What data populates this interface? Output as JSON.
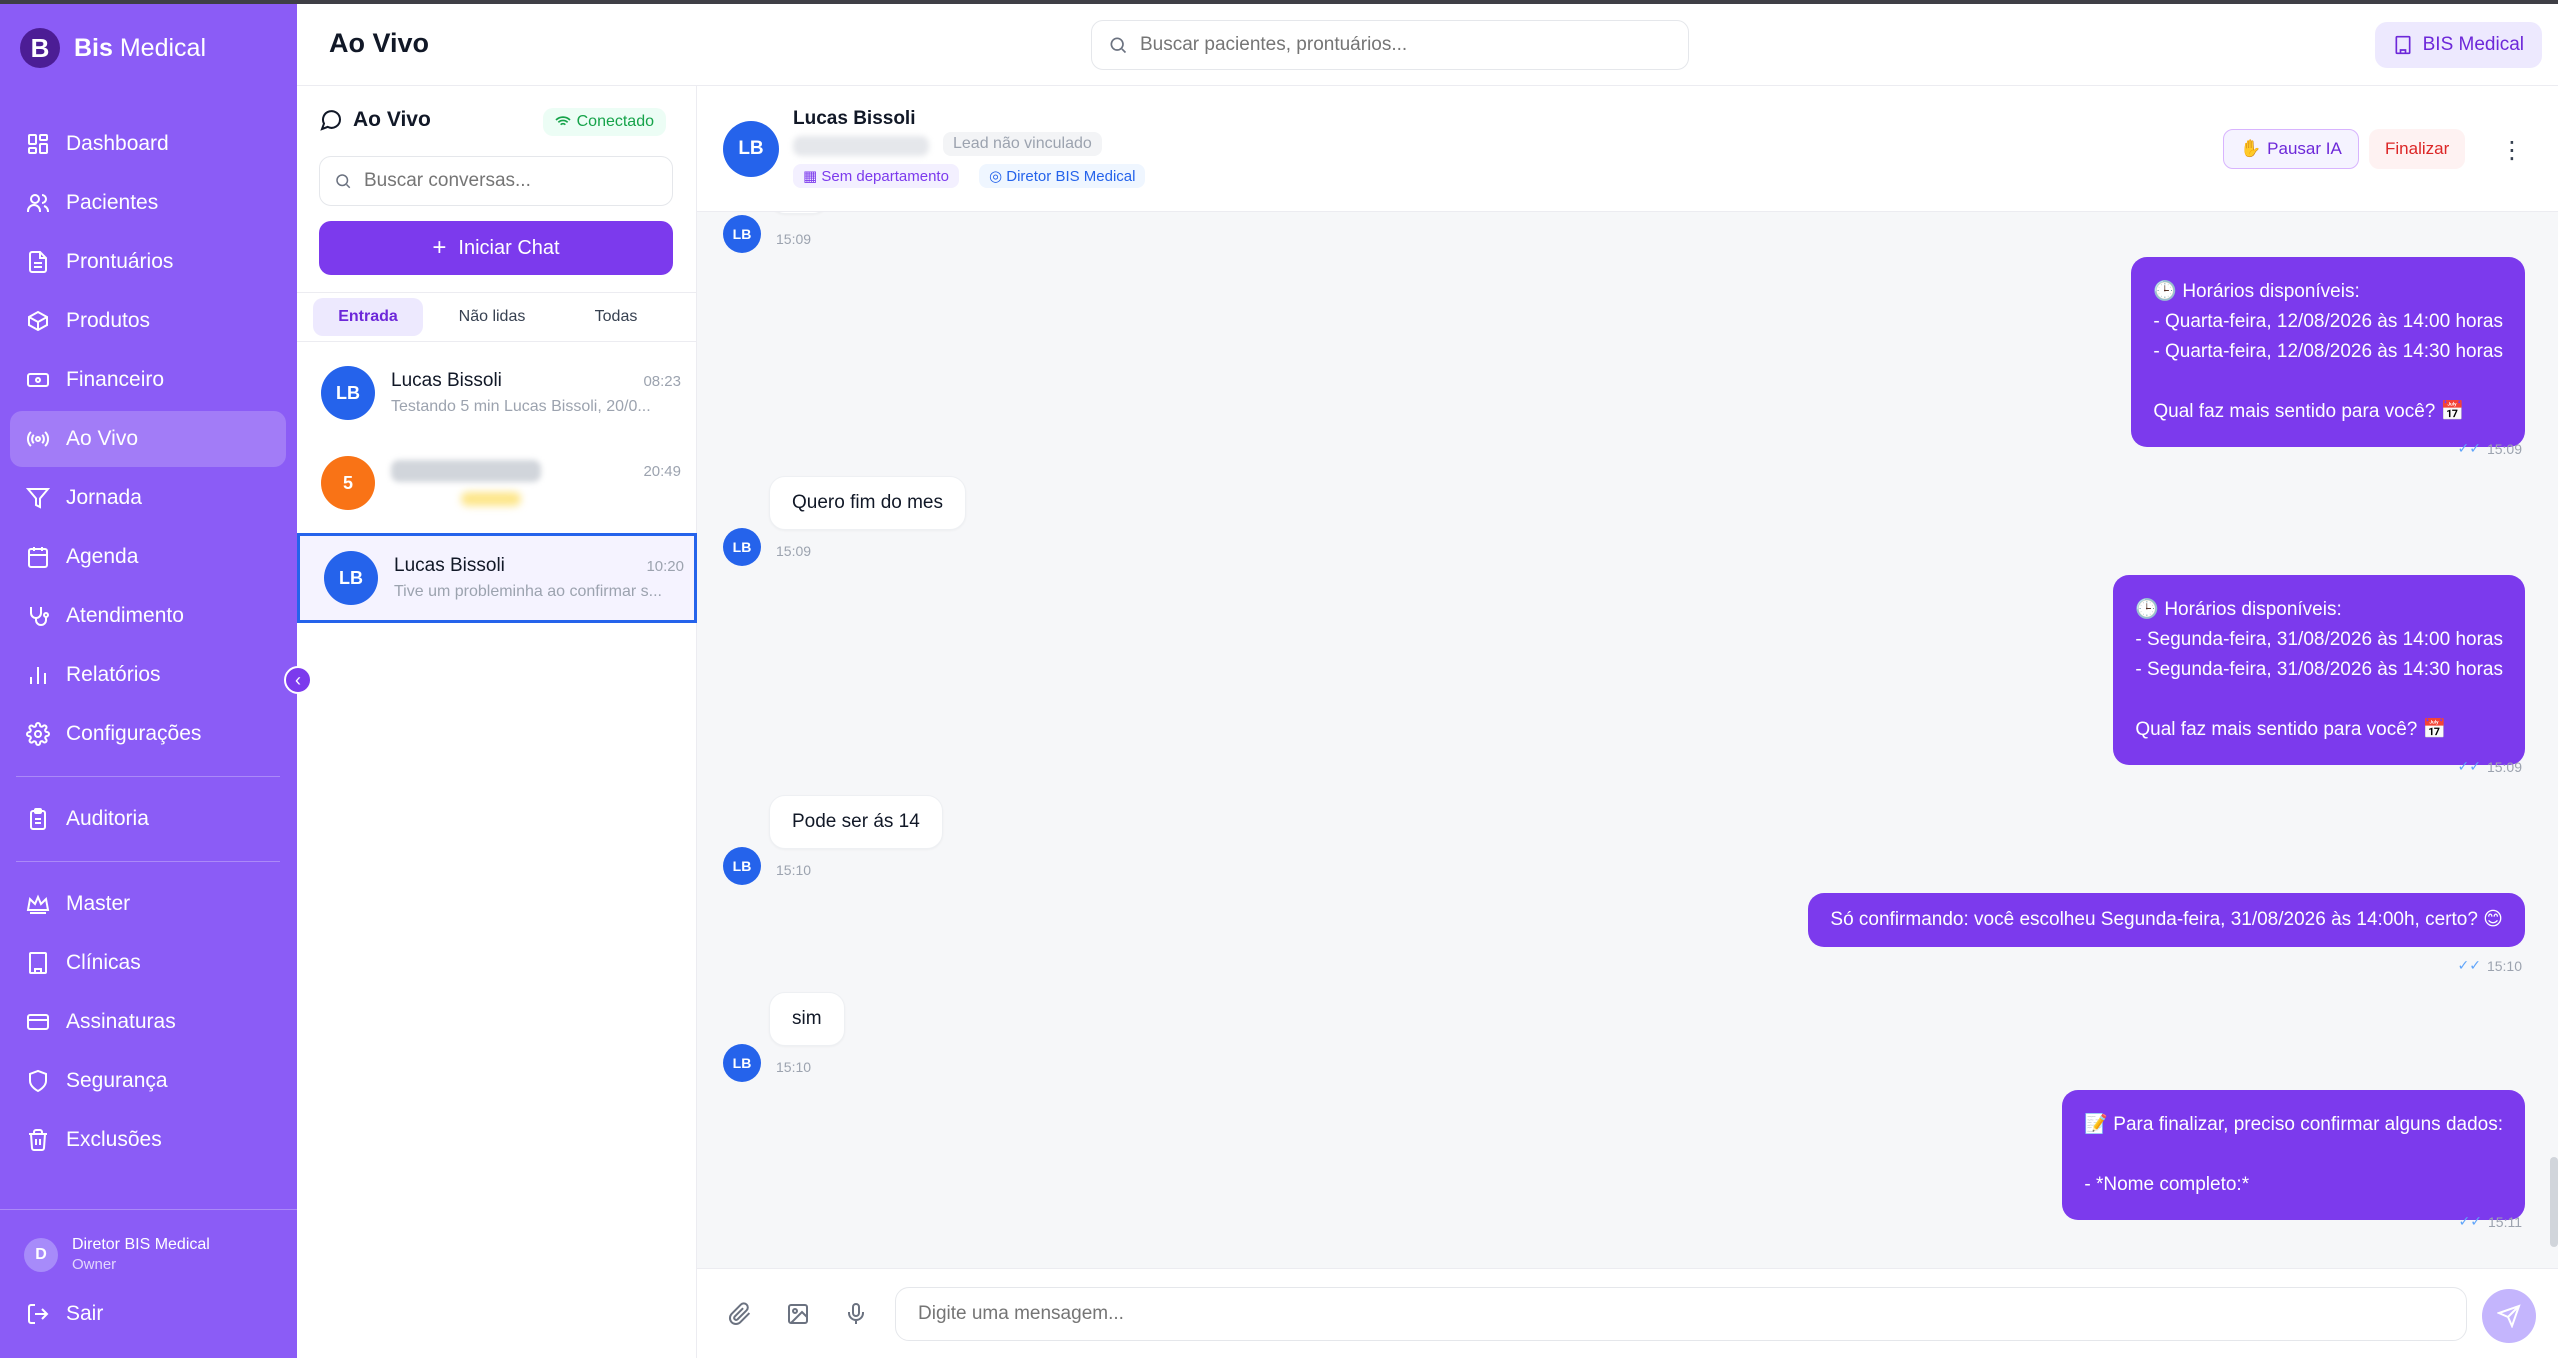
{
  "brand": {
    "logo_letter": "B",
    "name_bold": "Bis",
    "name_rest": " Medical"
  },
  "sidebar": {
    "items": [
      {
        "label": "Dashboard",
        "icon": "dashboard-icon"
      },
      {
        "label": "Pacientes",
        "icon": "users-icon"
      },
      {
        "label": "Prontuários",
        "icon": "document-icon"
      },
      {
        "label": "Produtos",
        "icon": "box-icon"
      },
      {
        "label": "Financeiro",
        "icon": "money-icon"
      },
      {
        "label": "Ao Vivo",
        "icon": "radio-icon",
        "active": true
      },
      {
        "label": "Jornada",
        "icon": "filter-icon"
      },
      {
        "label": "Agenda",
        "icon": "calendar-icon"
      },
      {
        "label": "Atendimento",
        "icon": "stethoscope-icon"
      },
      {
        "label": "Relatórios",
        "icon": "chart-icon"
      },
      {
        "label": "Configurações",
        "icon": "gear-icon"
      }
    ],
    "audit": {
      "label": "Auditoria",
      "icon": "clipboard-icon"
    },
    "admin_items": [
      {
        "label": "Master",
        "icon": "crown-icon"
      },
      {
        "label": "Clínicas",
        "icon": "building-icon"
      },
      {
        "label": "Assinaturas",
        "icon": "card-icon"
      },
      {
        "label": "Segurança",
        "icon": "shield-icon"
      },
      {
        "label": "Exclusões",
        "icon": "trash-icon"
      }
    ],
    "user": {
      "initial": "D",
      "name": "Diretor BIS Medical",
      "role": "Owner"
    },
    "logout_label": "Sair"
  },
  "header": {
    "title": "Ao Vivo",
    "search_placeholder": "Buscar pacientes, prontuários...",
    "org_label": "BIS Medical"
  },
  "conversations": {
    "title": "Ao Vivo",
    "status": "Conectado",
    "search_placeholder": "Buscar conversas...",
    "start_chat_label": "Iniciar Chat",
    "tabs": [
      "Entrada",
      "Não lidas",
      "Todas"
    ],
    "active_tab": "Entrada",
    "items": [
      {
        "initials": "LB",
        "name": "Lucas Bissoli",
        "time": "08:23",
        "preview": "Testando 5 min Lucas Bissoli, 20/0...",
        "avatar_color": "#2563eb"
      },
      {
        "initials": "5",
        "name": "",
        "time": "20:49",
        "preview": "",
        "avatar_color": "#f97316"
      },
      {
        "initials": "LB",
        "name": "Lucas Bissoli",
        "time": "10:20",
        "preview": "Tive um probleminha ao confirmar s...",
        "avatar_color": "#2563eb",
        "selected": true
      }
    ]
  },
  "chat": {
    "contact": {
      "initials": "LB",
      "name": "Lucas Bissoli",
      "lead_status": "Lead não vinculado",
      "department_tag": "Sem departamento",
      "owner_tag": "Diretor BIS Medical"
    },
    "pause_label": "Pausar IA",
    "pause_emoji": "✋",
    "finish_label": "Finalizar",
    "messages": [
      {
        "dir": "in",
        "initials": "LB",
        "text": "",
        "time": "15:09"
      },
      {
        "dir": "out",
        "text": "🕒 Horários disponíveis:\n- Quarta-feira, 12/08/2026 às 14:00 horas\n- Quarta-feira, 12/08/2026 às 14:30 horas\n\nQual faz mais sentido para você? 📅",
        "time": "15:09"
      },
      {
        "dir": "in",
        "initials": "LB",
        "text": "Quero fim do mes",
        "time": "15:09"
      },
      {
        "dir": "out",
        "text": "🕒 Horários disponíveis:\n- Segunda-feira, 31/08/2026 às 14:00 horas\n- Segunda-feira, 31/08/2026 às 14:30 horas\n\nQual faz mais sentido para você? 📅",
        "time": "15:09"
      },
      {
        "dir": "in",
        "initials": "LB",
        "text": "Pode ser ás 14",
        "time": "15:10"
      },
      {
        "dir": "out",
        "text": "Só confirmando: você escolheu Segunda-feira, 31/08/2026 às 14:00h, certo? 😊",
        "time": "15:10"
      },
      {
        "dir": "in",
        "initials": "LB",
        "text": "sim",
        "time": "15:10"
      },
      {
        "dir": "out",
        "text": "📝 Para finalizar, preciso confirmar alguns dados:\n\n- *Nome completo:*",
        "time": "15:11"
      }
    ],
    "composer_placeholder": "Digite uma mensagem..."
  },
  "colors": {
    "primary": "#7c3aed",
    "sidebar": "#8b5cf6",
    "avatar_blue": "#2563eb",
    "success": "#16a34a",
    "danger": "#dc2626"
  }
}
